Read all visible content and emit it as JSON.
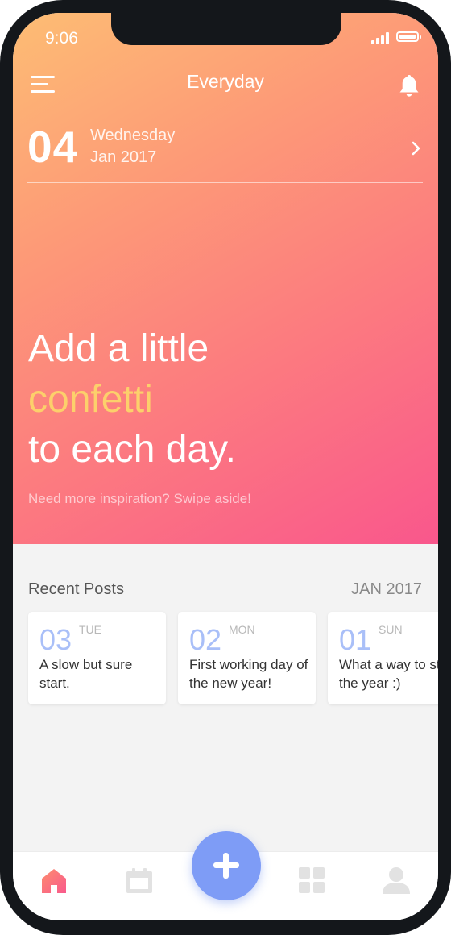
{
  "status_bar": {
    "time": "9:06"
  },
  "header": {
    "title": "Everyday"
  },
  "date": {
    "day_number": "04",
    "weekday": "Wednesday",
    "month_year": "Jan 2017"
  },
  "hero": {
    "line1": "Add a little",
    "line2": "confetti",
    "line3": "to each day.",
    "hint": "Need more inspiration? Swipe aside!"
  },
  "recent": {
    "title": "Recent Posts",
    "month": "JAN 2017",
    "posts": [
      {
        "day": "03",
        "weekday": "TUE",
        "text": "A slow but sure start."
      },
      {
        "day": "02",
        "weekday": "MON",
        "text": "First working day of the new year!"
      },
      {
        "day": "01",
        "weekday": "SUN",
        "text": "What a way to start the year :)"
      }
    ]
  },
  "tabs": [
    {
      "icon": "home-icon",
      "active": true
    },
    {
      "icon": "calendar-icon",
      "active": false
    },
    {
      "icon": "plus-icon",
      "active": false
    },
    {
      "icon": "grid-icon",
      "active": false
    },
    {
      "icon": "profile-icon",
      "active": false
    }
  ],
  "colors": {
    "gradient_start": "#fdbd74",
    "gradient_end": "#f9578c",
    "highlight": "#fcd06b",
    "accent_blue": "#7e9cf6",
    "card_number": "#a9bff8"
  }
}
